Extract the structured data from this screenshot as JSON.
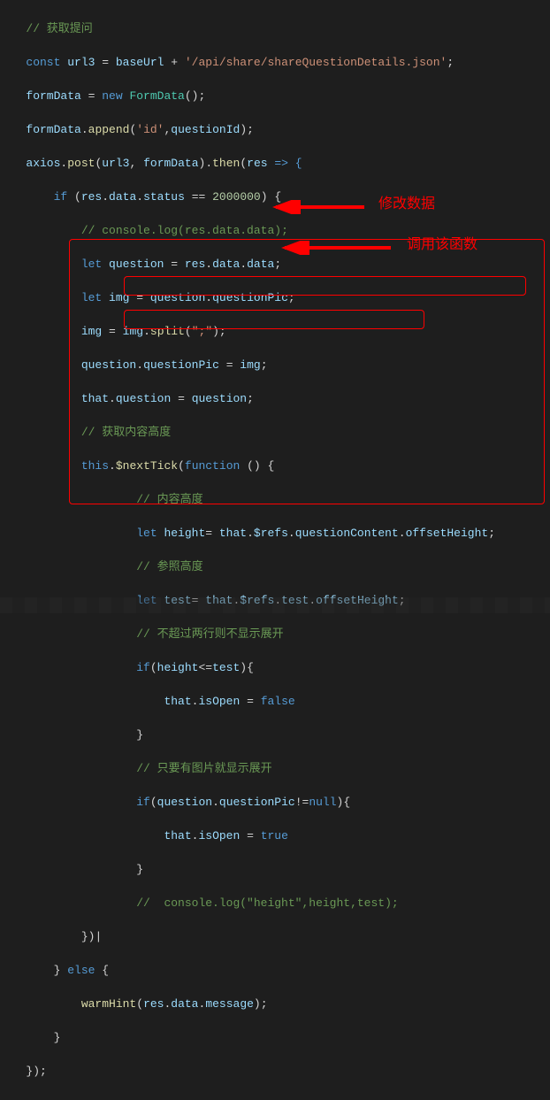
{
  "annotations": {
    "label1": "修改数据",
    "label2": "调用该函数"
  },
  "code": {
    "l01_a": "// 获取提问",
    "l02_a": "const",
    "l02_b": " url3 ",
    "l02_c": "=",
    "l02_d": " baseUrl ",
    "l02_e": "+",
    "l02_f": " '/api/share/shareQuestionDetails.json'",
    "l02_g": ";",
    "l03_a": "formData ",
    "l03_b": "=",
    "l03_c": " new ",
    "l03_d": "FormData",
    "l03_e": "();",
    "l04_a": "formData",
    "l04_b": ".",
    "l04_c": "append",
    "l04_d": "(",
    "l04_e": "'id'",
    "l04_f": ",",
    "l04_g": "questionId",
    "l04_h": ");",
    "l05_a": "axios",
    "l05_b": ".",
    "l05_c": "post",
    "l05_d": "(",
    "l05_e": "url3",
    "l05_f": ", ",
    "l05_g": "formData",
    "l05_h": ").",
    "l05_i": "then",
    "l05_j": "(",
    "l05_k": "res",
    "l05_l": " => {",
    "l06_a": "if",
    "l06_b": " (",
    "l06_c": "res",
    "l06_d": ".",
    "l06_e": "data",
    "l06_f": ".",
    "l06_g": "status",
    "l06_h": " == ",
    "l06_i": "2000000",
    "l06_j": ") {",
    "l07_a": "// console.log(res.data.data);",
    "l08_a": "let",
    "l08_b": " question ",
    "l08_c": "=",
    "l08_d": " res",
    "l08_e": ".",
    "l08_f": "data",
    "l08_g": ".",
    "l08_h": "data",
    "l08_i": ";",
    "l09_a": "let",
    "l09_b": " img ",
    "l09_c": "=",
    "l09_d": " question",
    "l09_e": ".",
    "l09_f": "questionPic",
    "l09_g": ";",
    "l10_a": "img ",
    "l10_b": "=",
    "l10_c": " img",
    "l10_d": ".",
    "l10_e": "split",
    "l10_f": "(",
    "l10_g": "\";\"",
    "l10_h": ");",
    "l11_a": "question",
    "l11_b": ".",
    "l11_c": "questionPic",
    "l11_d": " = ",
    "l11_e": "img",
    "l11_f": ";",
    "l12_a": "that",
    "l12_b": ".",
    "l12_c": "question",
    "l12_d": " = ",
    "l12_e": "question",
    "l12_f": ";",
    "l13_a": "// 获取内容高度",
    "l14_a": "this",
    "l14_b": ".",
    "l14_c": "$nextTick",
    "l14_d": "(",
    "l14_e": "function",
    "l14_f": " () {",
    "l15_a": "// 内容高度",
    "l16_a": "let",
    "l16_b": " height",
    "l16_c": "= ",
    "l16_d": "that",
    "l16_e": ".",
    "l16_f": "$refs",
    "l16_g": ".",
    "l16_h": "questionContent",
    "l16_i": ".",
    "l16_j": "offsetHeight",
    "l16_k": ";",
    "l17_a": "// 参照高度",
    "l18_a": "let",
    "l18_b": " test",
    "l18_c": "= ",
    "l18_d": "that",
    "l18_e": ".",
    "l18_f": "$refs",
    "l18_g": ".",
    "l18_h": "test",
    "l18_i": ".",
    "l18_j": "offsetHeight",
    "l18_k": ";",
    "l19_a": "// 不超过两行则不显示展开",
    "l20_a": "if",
    "l20_b": "(",
    "l20_c": "height",
    "l20_d": "<=",
    "l20_e": "test",
    "l20_f": "){",
    "l21_a": "that",
    "l21_b": ".",
    "l21_c": "isOpen",
    "l21_d": " = ",
    "l21_e": "false",
    "l22_a": "}",
    "l23_a": "// 只要有图片就显示展开",
    "l24_a": "if",
    "l24_b": "(",
    "l24_c": "question",
    "l24_d": ".",
    "l24_e": "questionPic",
    "l24_f": "!=",
    "l24_g": "null",
    "l24_h": "){",
    "l25_a": "that",
    "l25_b": ".",
    "l25_c": "isOpen",
    "l25_d": " = ",
    "l25_e": "true",
    "l26_a": "}",
    "l27_a": "//  console.log(\"height\",height,test);",
    "l28_a": "})",
    "l28_b": "|",
    "l29_a": "} ",
    "l29_b": "else",
    "l29_c": " {",
    "l30_a": "warmHint",
    "l30_b": "(",
    "l30_c": "res",
    "l30_d": ".",
    "l30_e": "data",
    "l30_f": ".",
    "l30_g": "message",
    "l30_h": ");",
    "l31_a": "}",
    "l32_a": "});"
  }
}
